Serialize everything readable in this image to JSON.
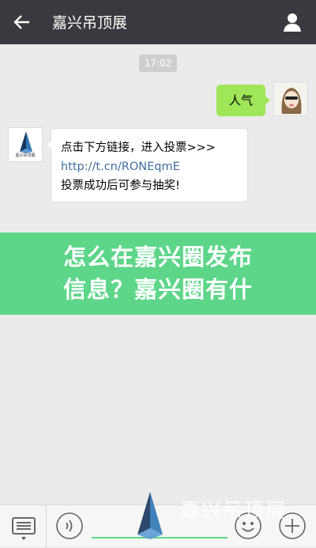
{
  "header": {
    "title": "嘉兴吊顶展",
    "back_icon": "back-arrow-icon",
    "profile_icon": "person-icon"
  },
  "chat": {
    "timestamp": "17:02",
    "outgoing": {
      "text": "人气"
    },
    "incoming": {
      "line1": "点击下方链接，进入投票>>>",
      "link": "http://t.cn/RONEqmE",
      "line3": "投票成功后可参与抽奖!",
      "avatar_caption": "嘉兴吊顶展"
    }
  },
  "overlay": {
    "line1": "怎么在嘉兴圈发布",
    "line2": "信息？嘉兴圈有什"
  },
  "bottom_bar": {
    "menu_icon": "keyboard-menu-icon",
    "voice_icon": "voice-icon",
    "emoji_icon": "emoji-icon",
    "plus_icon": "plus-icon"
  },
  "watermark": {
    "text": "嘉兴吊顶展"
  },
  "colors": {
    "topbar": "#393a3f",
    "outgoing_bubble": "#9fe658",
    "overlay_banner": "#5ed68a",
    "link": "#3e6c9f",
    "background": "#ebebeb"
  }
}
